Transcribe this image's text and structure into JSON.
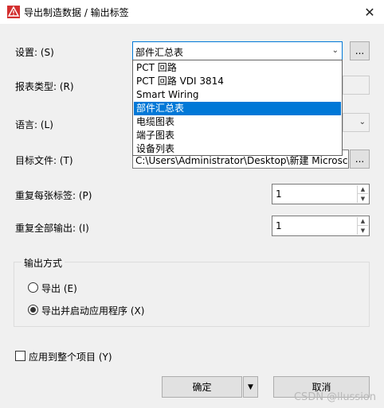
{
  "window": {
    "title": "导出制造数据 / 输出标签",
    "close_glyph": "✕"
  },
  "settings": {
    "label": "设置: (S)",
    "value": "部件汇总表",
    "more_label": "..."
  },
  "dropdown": {
    "items": [
      {
        "label": "PCT 回路"
      },
      {
        "label": "PCT 回路 VDI 3814"
      },
      {
        "label": "Smart Wiring"
      },
      {
        "label": "部件汇总表"
      },
      {
        "label": "电缆图表"
      },
      {
        "label": "端子图表"
      },
      {
        "label": "设备列表"
      }
    ],
    "selected_index": 3
  },
  "report_type": {
    "label": "报表类型: (R)"
  },
  "language": {
    "label": "语言: (L)"
  },
  "target_file": {
    "label": "目标文件: (T)",
    "value": "C:\\Users\\Administrator\\Desktop\\新建 Microsc",
    "more_label": "..."
  },
  "repeat_each": {
    "label": "重复每张标签: (P)",
    "value": "1"
  },
  "repeat_all": {
    "label": "重复全部输出: (I)",
    "value": "1"
  },
  "output_mode": {
    "title": "输出方式",
    "options": [
      {
        "label": "导出 (E)",
        "checked": false
      },
      {
        "label": "导出并启动应用程序 (X)",
        "checked": true
      }
    ]
  },
  "apply_all": {
    "label": "应用到整个项目 (Y)",
    "checked": false
  },
  "buttons": {
    "ok": "确定",
    "cancel": "取消"
  },
  "watermark": "CSDN @llussion",
  "colors": {
    "accent": "#0078d7",
    "title_icon": "#d32f2f"
  }
}
